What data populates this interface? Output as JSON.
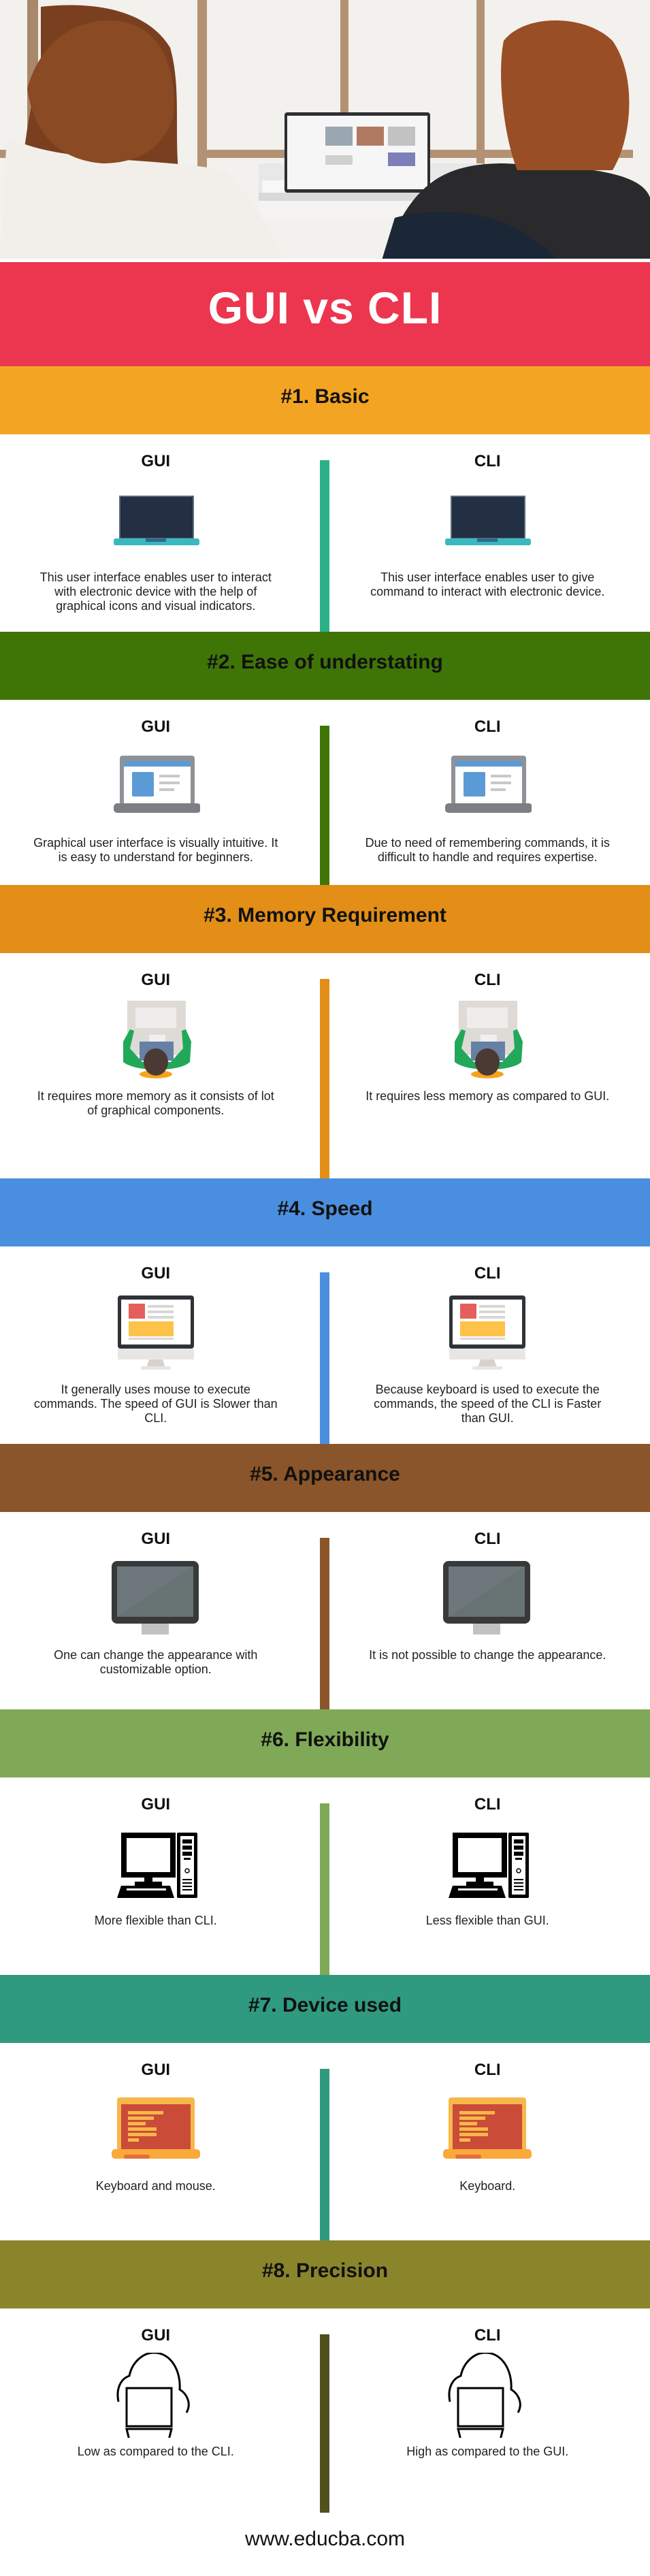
{
  "hero": {
    "image": "photo-two-people-at-laptop"
  },
  "title": {
    "text": "GUI vs CLI",
    "color": "#ec364f"
  },
  "columns": {
    "left_label": "GUI",
    "right_label": "CLI"
  },
  "sections": [
    {
      "heading": "#1. Basic",
      "color": "#f4a423",
      "divider_color": "#2bb08a",
      "icon": "laptop-dark-icon",
      "gui": "This user interface enables user to interact with electronic device with the help of graphical icons and visual indicators.",
      "cli": "This user interface enables user to give command to interact with electronic device."
    },
    {
      "heading": "#2. Ease of understating",
      "color": "#3f7506",
      "divider_color": "#3f7506",
      "icon": "laptop-window-icon",
      "gui": "Graphical user interface is visually intuitive. It is easy to understand for beginners.",
      "cli": "Due to need of remembering commands, it is difficult to handle and requires expertise."
    },
    {
      "heading": "#3. Memory Requirement",
      "color": "#e28e17",
      "divider_color": "#e28e17",
      "icon": "person-at-desk-icon",
      "gui": "It requires more memory as it consists of lot of graphical components.",
      "cli": "It requires less memory as compared to GUI."
    },
    {
      "heading": "#4. Speed",
      "color": "#4a8fdf",
      "divider_color": "#4a8fdf",
      "icon": "desktop-monitor-icon",
      "gui": "It generally uses mouse to execute commands. The speed of GUI is Slower than CLI.",
      "cli": "Because keyboard is used to execute the commands, the speed of the CLI is Faster than GUI."
    },
    {
      "heading": "#5. Appearance",
      "color": "#8a552a",
      "divider_color": "#8a552a",
      "icon": "monitor-grey-icon",
      "gui": "One can change the appearance with customizable option.",
      "cli": "It is not possible to change the appearance."
    },
    {
      "heading": "#6. Flexibility",
      "color": "#7fa957",
      "divider_color": "#7fa957",
      "icon": "desktop-pc-icon",
      "gui": "More flexible than CLI.",
      "cli": "Less flexible than GUI."
    },
    {
      "heading": "#7. Device used",
      "color": "#2f9a80",
      "divider_color": "#2f9a80",
      "icon": "laptop-orange-icon",
      "gui": "Keyboard and mouse.",
      "cli": "Keyboard."
    },
    {
      "heading": "#8. Precision",
      "color": "#8a842b",
      "divider_color": "#52501c",
      "icon": "cloud-laptop-icon",
      "gui": "Low as compared to the CLI.",
      "cli": "High as compared to the GUI."
    }
  ],
  "footer": {
    "text": "www.educba.com"
  }
}
